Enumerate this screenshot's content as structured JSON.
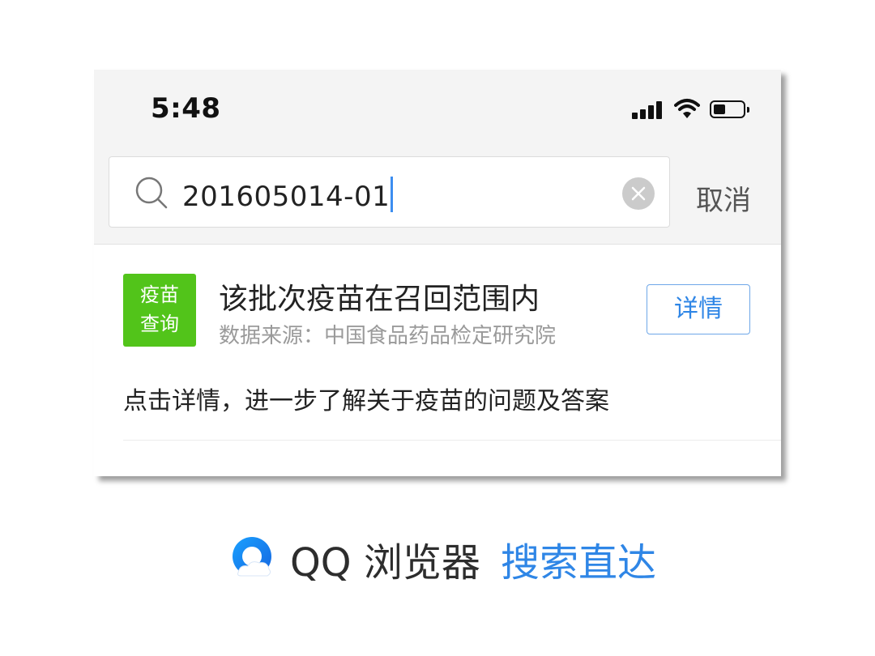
{
  "status_bar": {
    "time": "5:48"
  },
  "search": {
    "value": "201605014-01",
    "cancel_label": "取消"
  },
  "result": {
    "tag_line1": "疫苗",
    "tag_line2": "查询",
    "title": "该批次疫苗在召回范围内",
    "source": "数据来源：中国食品药品检定研究院",
    "detail_label": "详情",
    "description": "点击详情，进一步了解关于疫苗的问题及答案"
  },
  "brand": {
    "name": "QQ 浏览器",
    "slogan": "搜索直达"
  },
  "colors": {
    "accent": "#2f86e6",
    "tag_green": "#52c41a",
    "caret": "#3d8ef0"
  },
  "icons": [
    "search-icon",
    "clear-icon",
    "signal-icon",
    "wifi-icon",
    "battery-icon",
    "qq-browser-logo-icon"
  ]
}
